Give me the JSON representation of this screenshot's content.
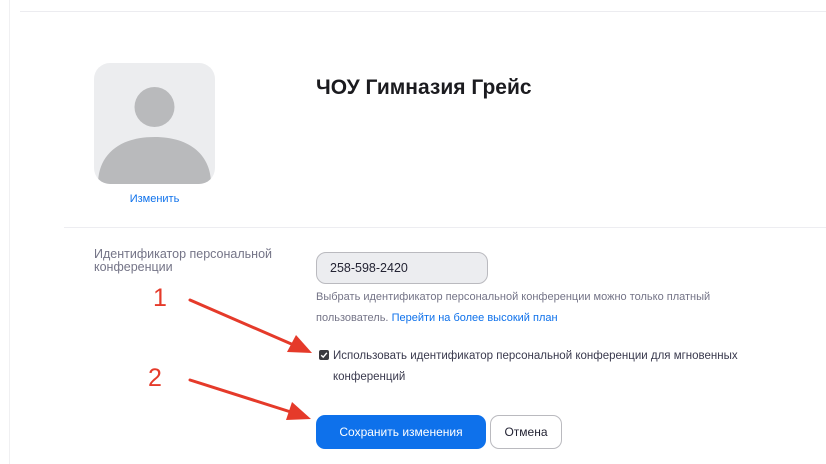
{
  "profile": {
    "name": "ЧОУ Гимназия Грейс",
    "change_label": "Изменить",
    "avatar_icon": "user-silhouette-icon"
  },
  "pmi": {
    "label": "Идентификатор персональной конференции",
    "value": "258-598-2420",
    "hint_text": "Выбрать идентификатор персональной конференции можно только платный пользователь.",
    "upgrade_link": "Перейти на более высокий план",
    "checkbox_label": "Использовать идентификатор персональной конференции для мгновенных конференций",
    "checkbox_checked": true
  },
  "actions": {
    "save_label": "Сохранить изменения",
    "cancel_label": "Отмена"
  },
  "annotations": {
    "marker_1": "1",
    "marker_2": "2",
    "arrow_color": "#e53a2a"
  },
  "colors": {
    "accent": "#0e71eb",
    "annotation": "#e53a2a"
  }
}
